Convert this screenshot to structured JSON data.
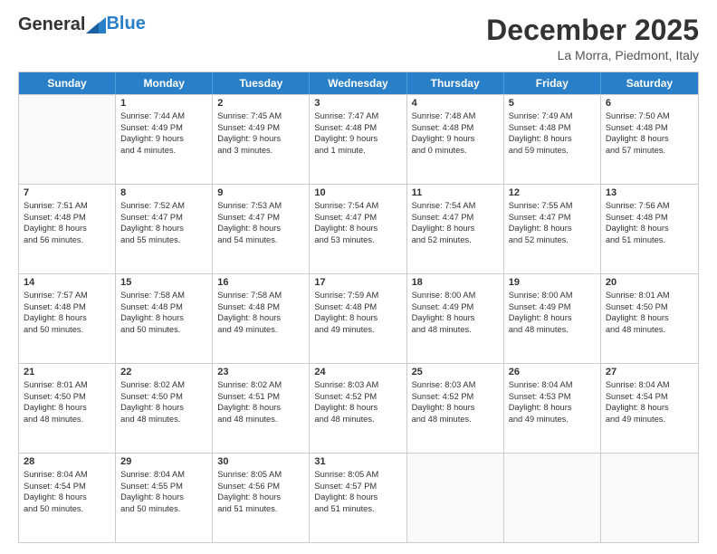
{
  "header": {
    "logo_line1": "General",
    "logo_line2": "Blue",
    "title": "December 2025",
    "subtitle": "La Morra, Piedmont, Italy"
  },
  "days": [
    "Sunday",
    "Monday",
    "Tuesday",
    "Wednesday",
    "Thursday",
    "Friday",
    "Saturday"
  ],
  "rows": [
    [
      {
        "day": "",
        "empty": true
      },
      {
        "day": "1",
        "sunrise": "Sunrise: 7:44 AM",
        "sunset": "Sunset: 4:49 PM",
        "daylight": "Daylight: 9 hours",
        "daylight2": "and 4 minutes."
      },
      {
        "day": "2",
        "sunrise": "Sunrise: 7:45 AM",
        "sunset": "Sunset: 4:49 PM",
        "daylight": "Daylight: 9 hours",
        "daylight2": "and 3 minutes."
      },
      {
        "day": "3",
        "sunrise": "Sunrise: 7:47 AM",
        "sunset": "Sunset: 4:48 PM",
        "daylight": "Daylight: 9 hours",
        "daylight2": "and 1 minute."
      },
      {
        "day": "4",
        "sunrise": "Sunrise: 7:48 AM",
        "sunset": "Sunset: 4:48 PM",
        "daylight": "Daylight: 9 hours",
        "daylight2": "and 0 minutes."
      },
      {
        "day": "5",
        "sunrise": "Sunrise: 7:49 AM",
        "sunset": "Sunset: 4:48 PM",
        "daylight": "Daylight: 8 hours",
        "daylight2": "and 59 minutes."
      },
      {
        "day": "6",
        "sunrise": "Sunrise: 7:50 AM",
        "sunset": "Sunset: 4:48 PM",
        "daylight": "Daylight: 8 hours",
        "daylight2": "and 57 minutes."
      }
    ],
    [
      {
        "day": "7",
        "sunrise": "Sunrise: 7:51 AM",
        "sunset": "Sunset: 4:48 PM",
        "daylight": "Daylight: 8 hours",
        "daylight2": "and 56 minutes."
      },
      {
        "day": "8",
        "sunrise": "Sunrise: 7:52 AM",
        "sunset": "Sunset: 4:47 PM",
        "daylight": "Daylight: 8 hours",
        "daylight2": "and 55 minutes."
      },
      {
        "day": "9",
        "sunrise": "Sunrise: 7:53 AM",
        "sunset": "Sunset: 4:47 PM",
        "daylight": "Daylight: 8 hours",
        "daylight2": "and 54 minutes."
      },
      {
        "day": "10",
        "sunrise": "Sunrise: 7:54 AM",
        "sunset": "Sunset: 4:47 PM",
        "daylight": "Daylight: 8 hours",
        "daylight2": "and 53 minutes."
      },
      {
        "day": "11",
        "sunrise": "Sunrise: 7:54 AM",
        "sunset": "Sunset: 4:47 PM",
        "daylight": "Daylight: 8 hours",
        "daylight2": "and 52 minutes."
      },
      {
        "day": "12",
        "sunrise": "Sunrise: 7:55 AM",
        "sunset": "Sunset: 4:47 PM",
        "daylight": "Daylight: 8 hours",
        "daylight2": "and 52 minutes."
      },
      {
        "day": "13",
        "sunrise": "Sunrise: 7:56 AM",
        "sunset": "Sunset: 4:48 PM",
        "daylight": "Daylight: 8 hours",
        "daylight2": "and 51 minutes."
      }
    ],
    [
      {
        "day": "14",
        "sunrise": "Sunrise: 7:57 AM",
        "sunset": "Sunset: 4:48 PM",
        "daylight": "Daylight: 8 hours",
        "daylight2": "and 50 minutes."
      },
      {
        "day": "15",
        "sunrise": "Sunrise: 7:58 AM",
        "sunset": "Sunset: 4:48 PM",
        "daylight": "Daylight: 8 hours",
        "daylight2": "and 50 minutes."
      },
      {
        "day": "16",
        "sunrise": "Sunrise: 7:58 AM",
        "sunset": "Sunset: 4:48 PM",
        "daylight": "Daylight: 8 hours",
        "daylight2": "and 49 minutes."
      },
      {
        "day": "17",
        "sunrise": "Sunrise: 7:59 AM",
        "sunset": "Sunset: 4:48 PM",
        "daylight": "Daylight: 8 hours",
        "daylight2": "and 49 minutes."
      },
      {
        "day": "18",
        "sunrise": "Sunrise: 8:00 AM",
        "sunset": "Sunset: 4:49 PM",
        "daylight": "Daylight: 8 hours",
        "daylight2": "and 48 minutes."
      },
      {
        "day": "19",
        "sunrise": "Sunrise: 8:00 AM",
        "sunset": "Sunset: 4:49 PM",
        "daylight": "Daylight: 8 hours",
        "daylight2": "and 48 minutes."
      },
      {
        "day": "20",
        "sunrise": "Sunrise: 8:01 AM",
        "sunset": "Sunset: 4:50 PM",
        "daylight": "Daylight: 8 hours",
        "daylight2": "and 48 minutes."
      }
    ],
    [
      {
        "day": "21",
        "sunrise": "Sunrise: 8:01 AM",
        "sunset": "Sunset: 4:50 PM",
        "daylight": "Daylight: 8 hours",
        "daylight2": "and 48 minutes."
      },
      {
        "day": "22",
        "sunrise": "Sunrise: 8:02 AM",
        "sunset": "Sunset: 4:50 PM",
        "daylight": "Daylight: 8 hours",
        "daylight2": "and 48 minutes."
      },
      {
        "day": "23",
        "sunrise": "Sunrise: 8:02 AM",
        "sunset": "Sunset: 4:51 PM",
        "daylight": "Daylight: 8 hours",
        "daylight2": "and 48 minutes."
      },
      {
        "day": "24",
        "sunrise": "Sunrise: 8:03 AM",
        "sunset": "Sunset: 4:52 PM",
        "daylight": "Daylight: 8 hours",
        "daylight2": "and 48 minutes."
      },
      {
        "day": "25",
        "sunrise": "Sunrise: 8:03 AM",
        "sunset": "Sunset: 4:52 PM",
        "daylight": "Daylight: 8 hours",
        "daylight2": "and 48 minutes."
      },
      {
        "day": "26",
        "sunrise": "Sunrise: 8:04 AM",
        "sunset": "Sunset: 4:53 PM",
        "daylight": "Daylight: 8 hours",
        "daylight2": "and 49 minutes."
      },
      {
        "day": "27",
        "sunrise": "Sunrise: 8:04 AM",
        "sunset": "Sunset: 4:54 PM",
        "daylight": "Daylight: 8 hours",
        "daylight2": "and 49 minutes."
      }
    ],
    [
      {
        "day": "28",
        "sunrise": "Sunrise: 8:04 AM",
        "sunset": "Sunset: 4:54 PM",
        "daylight": "Daylight: 8 hours",
        "daylight2": "and 50 minutes."
      },
      {
        "day": "29",
        "sunrise": "Sunrise: 8:04 AM",
        "sunset": "Sunset: 4:55 PM",
        "daylight": "Daylight: 8 hours",
        "daylight2": "and 50 minutes."
      },
      {
        "day": "30",
        "sunrise": "Sunrise: 8:05 AM",
        "sunset": "Sunset: 4:56 PM",
        "daylight": "Daylight: 8 hours",
        "daylight2": "and 51 minutes."
      },
      {
        "day": "31",
        "sunrise": "Sunrise: 8:05 AM",
        "sunset": "Sunset: 4:57 PM",
        "daylight": "Daylight: 8 hours",
        "daylight2": "and 51 minutes."
      },
      {
        "day": "",
        "empty": true
      },
      {
        "day": "",
        "empty": true
      },
      {
        "day": "",
        "empty": true
      }
    ]
  ]
}
